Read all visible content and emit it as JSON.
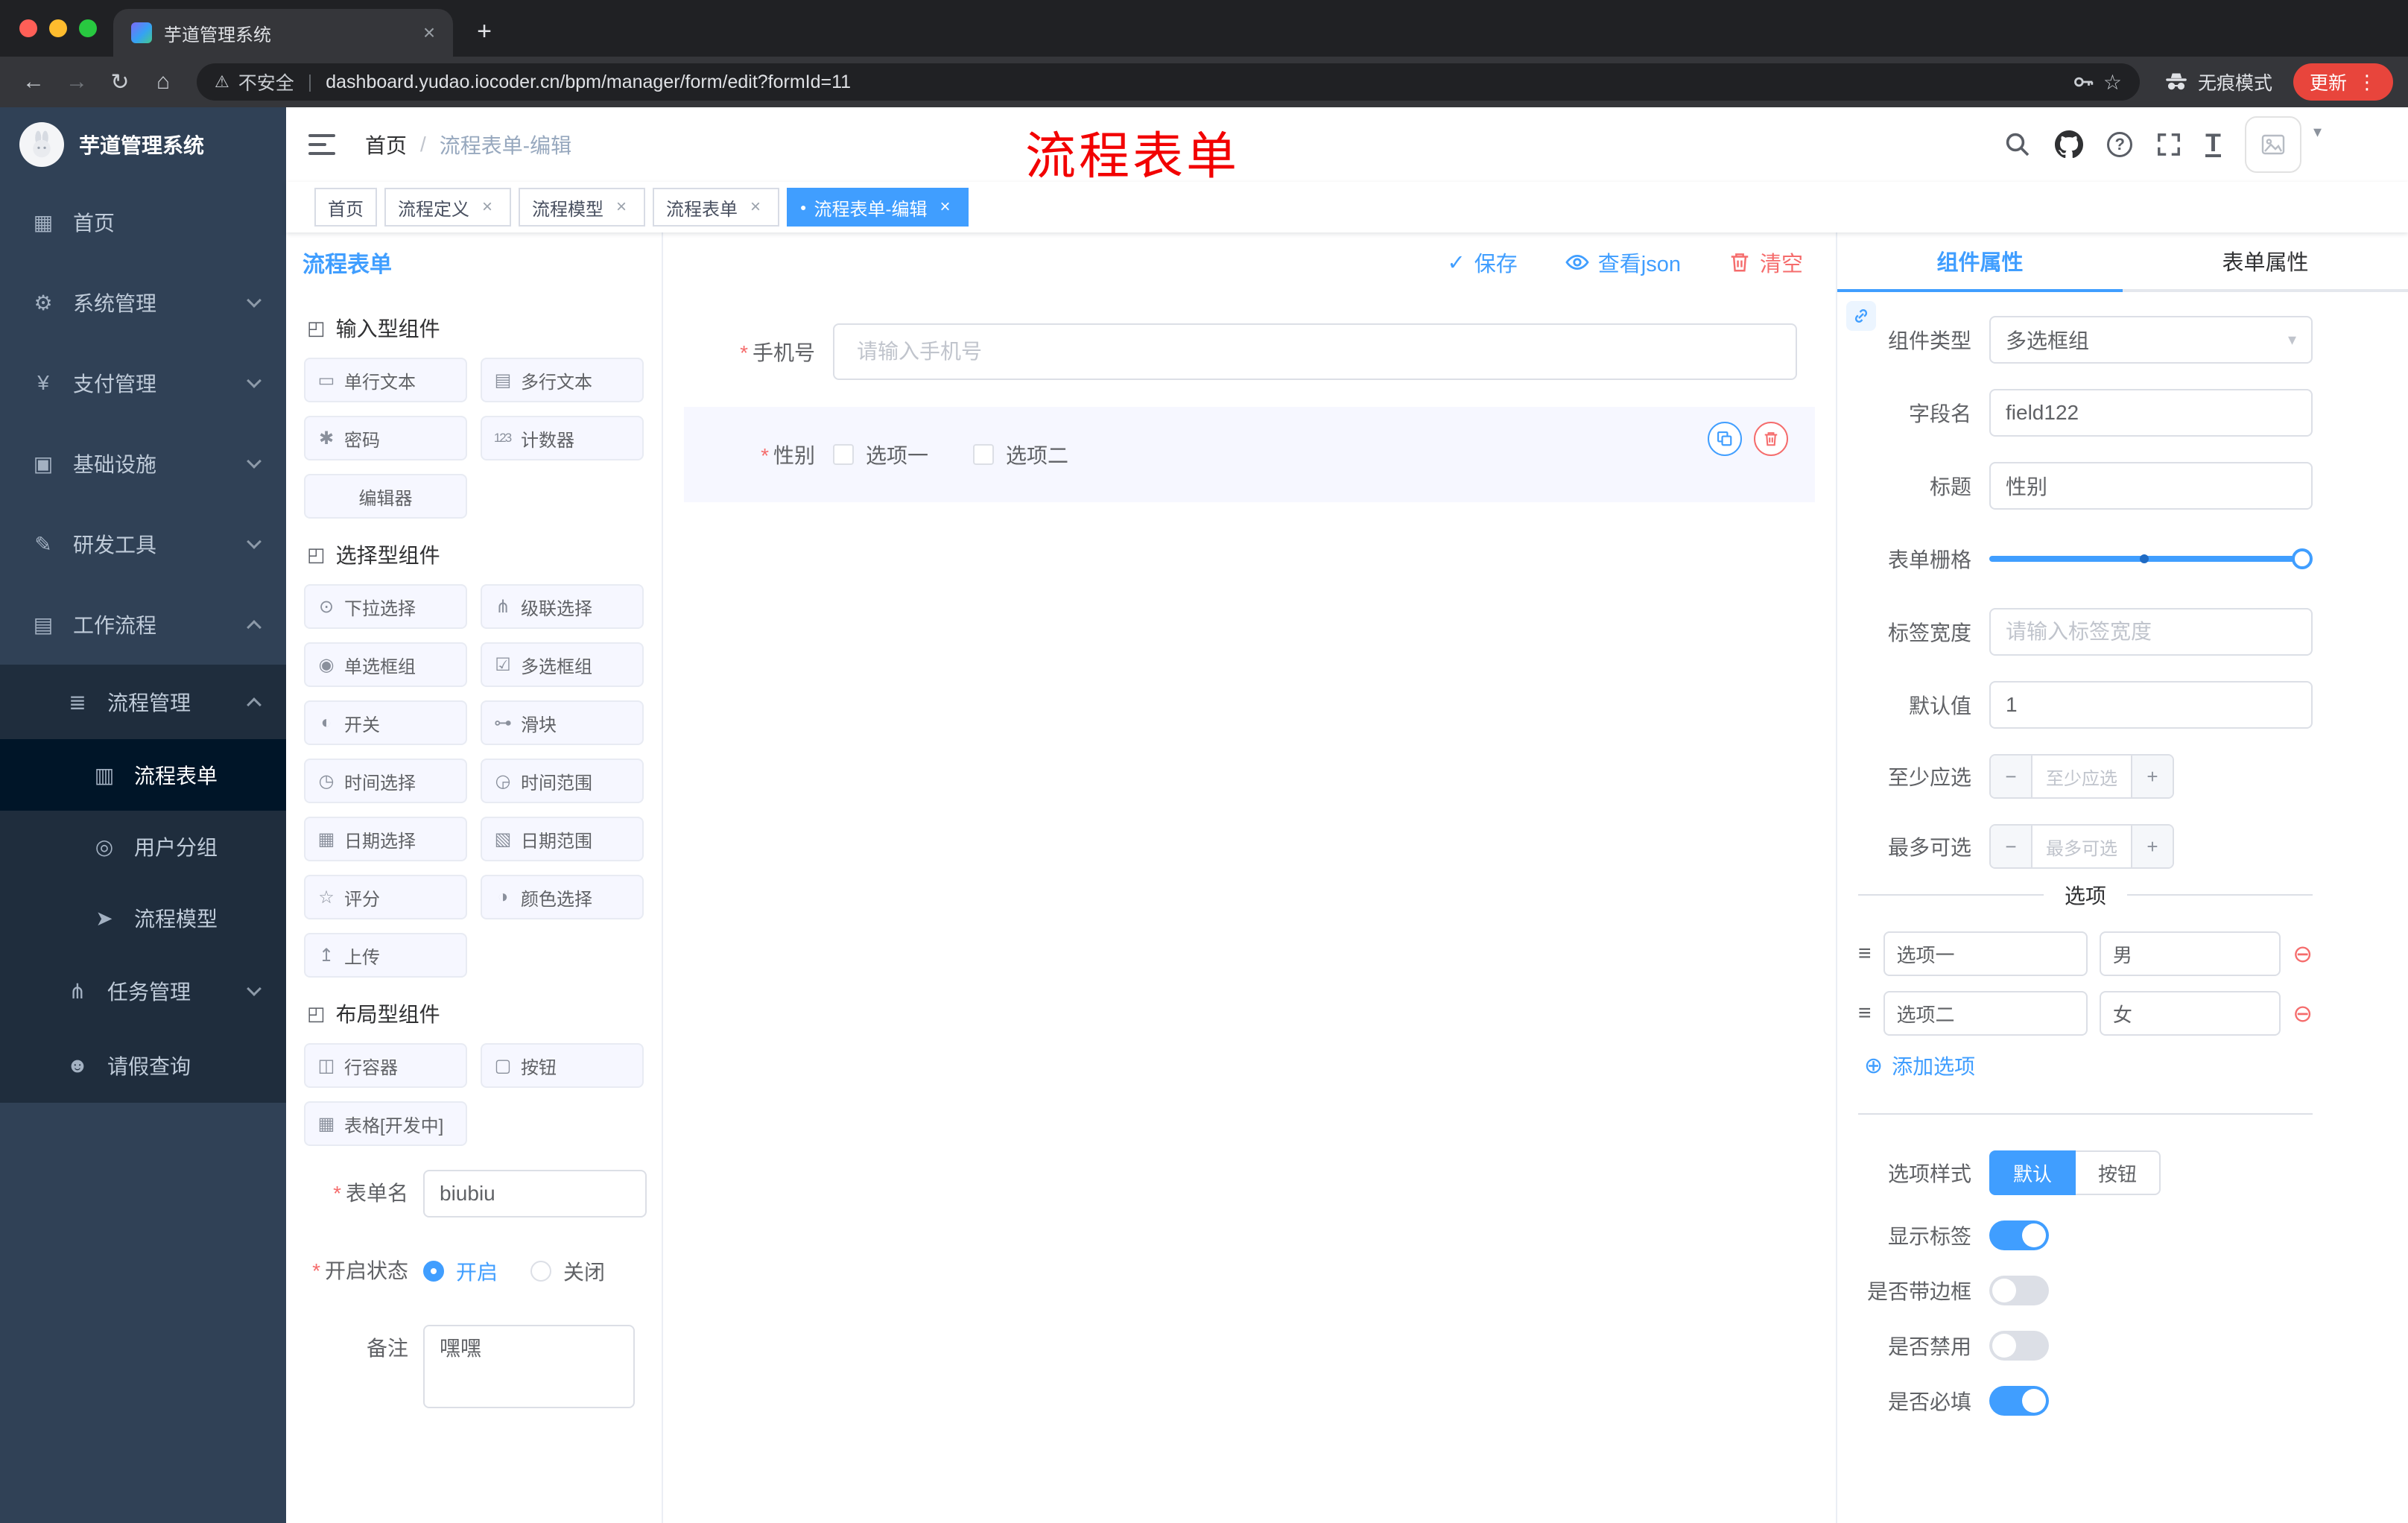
{
  "glyphs": {
    "close": "×",
    "plus": "+",
    "back": "←",
    "forward": "→",
    "reload": "↻",
    "home": "⌂",
    "warning": "⚠",
    "pipe": "|",
    "star": "☆",
    "kebab": "⋮",
    "caret_down": "▾",
    "check": "✓",
    "required": "*",
    "question": "?",
    "size": "T",
    "minus": "−",
    "circle_minus": "⊖",
    "circle_plus": "⊕",
    "drag": "≡",
    "dot": "●"
  },
  "browser": {
    "tab_title": "芋道管理系统",
    "security_label": "不安全",
    "url": "dashboard.yudao.iocoder.cn/bpm/manager/form/edit?formId=11",
    "incognito_label": "无痕模式",
    "update_label": "更新"
  },
  "header": {
    "breadcrumb_home": "首页",
    "breadcrumb_sep": "/",
    "breadcrumb_current": "流程表单-编辑",
    "annotation": "流程表单"
  },
  "sidebar": {
    "logo_title": "芋道管理系统",
    "menu": [
      {
        "label": "首页",
        "icon": "▦"
      },
      {
        "label": "系统管理",
        "icon": "⚙"
      },
      {
        "label": "支付管理",
        "icon": "¥"
      },
      {
        "label": "基础设施",
        "icon": "▣"
      },
      {
        "label": "研发工具",
        "icon": "✎"
      },
      {
        "label": "工作流程",
        "icon": "▤"
      }
    ],
    "submenu": {
      "process_mgmt": {
        "label": "流程管理",
        "icon": "≣"
      },
      "children": [
        {
          "label": "流程表单",
          "icon": "▥"
        },
        {
          "label": "用户分组",
          "icon": "◎"
        },
        {
          "label": "流程模型",
          "icon": "➤"
        }
      ],
      "task_mgmt": {
        "label": "任务管理",
        "icon": "⋔"
      },
      "leave_query": {
        "label": "请假查询",
        "icon": "☻"
      }
    }
  },
  "tags": [
    {
      "label": "首页"
    },
    {
      "label": "流程定义"
    },
    {
      "label": "流程模型"
    },
    {
      "label": "流程表单"
    },
    {
      "label": "流程表单-编辑"
    }
  ],
  "designer": {
    "panel_title": "流程表单",
    "save_label": "保存",
    "view_json_label": "查看json",
    "clear_label": "清空",
    "groups": [
      {
        "title": "输入型组件",
        "title_icon": "◰",
        "items": [
          {
            "label": "单行文本",
            "icon": "▭"
          },
          {
            "label": "多行文本",
            "icon": "▤"
          },
          {
            "label": "密码",
            "icon": "✱"
          },
          {
            "label": "计数器",
            "icon": "123"
          },
          {
            "label": "编辑器",
            "icon": ""
          }
        ]
      },
      {
        "title": "选择型组件",
        "title_icon": "◰",
        "items": [
          {
            "label": "下拉选择",
            "icon": "⊙"
          },
          {
            "label": "级联选择",
            "icon": "⋔"
          },
          {
            "label": "单选框组",
            "icon": "◉"
          },
          {
            "label": "多选框组",
            "icon": "☑"
          },
          {
            "label": "开关",
            "icon": "◐"
          },
          {
            "label": "滑块",
            "icon": "⊶"
          },
          {
            "label": "时间选择",
            "icon": "◷"
          },
          {
            "label": "时间范围",
            "icon": "◶"
          },
          {
            "label": "日期选择",
            "icon": "▦"
          },
          {
            "label": "日期范围",
            "icon": "▧"
          },
          {
            "label": "评分",
            "icon": "☆"
          },
          {
            "label": "颜色选择",
            "icon": "◑"
          },
          {
            "label": "上传",
            "icon": "↥"
          }
        ]
      },
      {
        "title": "布局型组件",
        "title_icon": "◰",
        "items": [
          {
            "label": "行容器",
            "icon": "◫"
          },
          {
            "label": "按钮",
            "icon": "▢"
          },
          {
            "label": "表格[开发中]",
            "icon": "▦"
          }
        ]
      }
    ],
    "meta_form": {
      "name_label": "表单名",
      "name_value": "biubiu",
      "status_label": "开启状态",
      "status_on": "开启",
      "status_off": "关闭",
      "remark_label": "备注",
      "remark_value": "嘿嘿"
    },
    "canvas": {
      "phone_label": "手机号",
      "phone_placeholder": "请输入手机号",
      "gender_label": "性别",
      "gender_options": [
        "选项一",
        "选项二"
      ]
    }
  },
  "props": {
    "tab_component": "组件属性",
    "tab_form": "表单属性",
    "component_type_label": "组件类型",
    "component_type_value": "多选框组",
    "field_name_label": "字段名",
    "field_name_value": "field122",
    "title_label": "标题",
    "title_value": "性别",
    "grid_label": "表单栅格",
    "label_width_label": "标签宽度",
    "label_width_placeholder": "请输入标签宽度",
    "default_label": "默认值",
    "default_value": "1",
    "min_label": "至少应选",
    "min_placeholder": "至少应选",
    "max_label": "最多可选",
    "max_placeholder": "最多可选",
    "options_title": "选项",
    "options": [
      {
        "label": "选项一",
        "value": "男"
      },
      {
        "label": "选项二",
        "value": "女"
      }
    ],
    "add_option_label": "添加选项",
    "option_style_label": "选项样式",
    "option_style_default": "默认",
    "option_style_button": "按钮",
    "switch_show_label": "显示标签",
    "switch_border": "是否带边框",
    "switch_disabled": "是否禁用",
    "switch_required": "是否必填"
  }
}
